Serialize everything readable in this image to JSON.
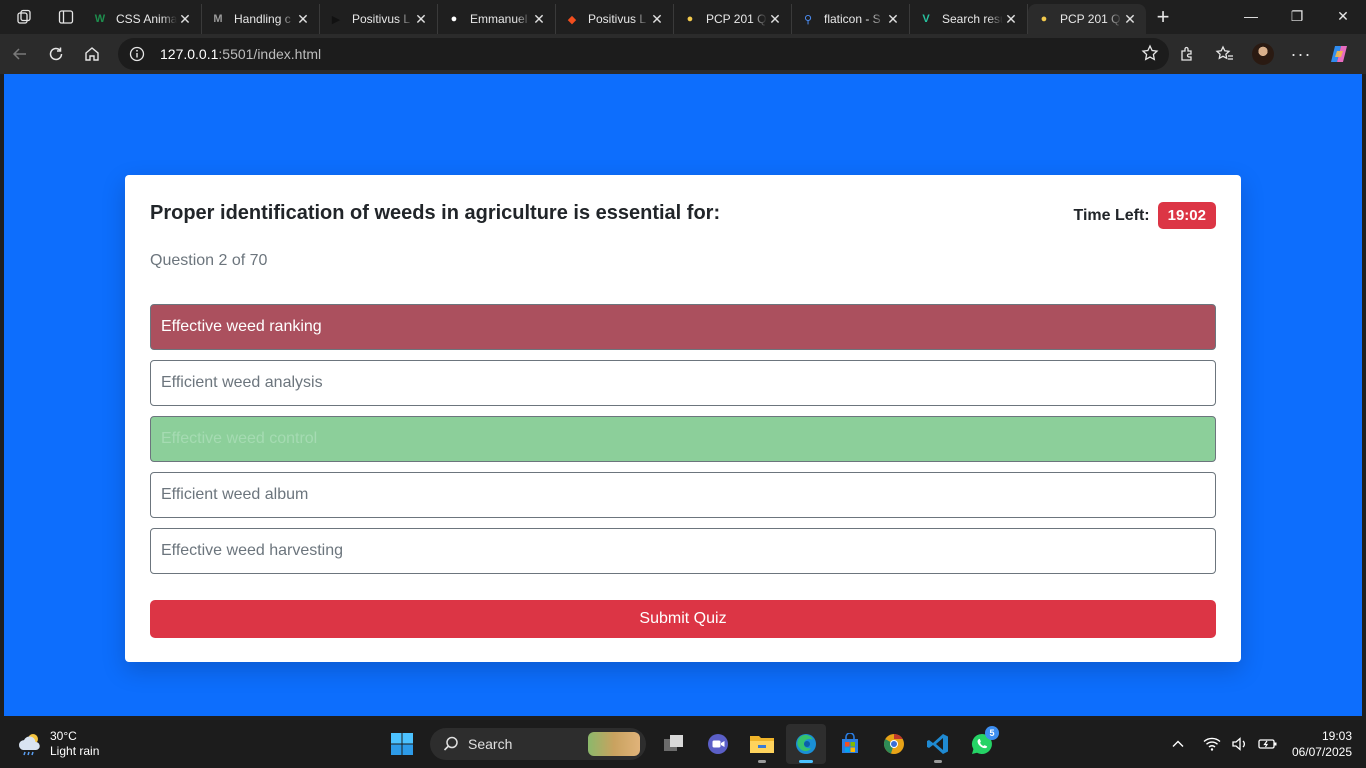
{
  "browser": {
    "tabs": [
      {
        "title": "CSS Anima",
        "favicon": "w-icon",
        "fav_color": "#1e8f4e"
      },
      {
        "title": "Handling c",
        "favicon": "m-icon",
        "fav_color": "#9a9a9a"
      },
      {
        "title": "Positivus L",
        "favicon": "play-icon",
        "fav_color": "#111111"
      },
      {
        "title": "Emmanuel",
        "favicon": "github-icon",
        "fav_color": "#ffffff"
      },
      {
        "title": "Positivus L",
        "favicon": "figma-icon",
        "fav_color": "#f24e1e"
      },
      {
        "title": "PCP 201 Q",
        "favicon": "bulb-icon",
        "fav_color": "#f2c94c"
      },
      {
        "title": "flaticon - S",
        "favicon": "search-icon",
        "fav_color": "#4c8ff7"
      },
      {
        "title": "Search resu",
        "favicon": "v-icon",
        "fav_color": "#27c3a0"
      },
      {
        "title": "PCP 201 Q",
        "favicon": "bulb-icon",
        "fav_color": "#f2c94c",
        "active": true
      }
    ],
    "url_host": "127.0.0.1",
    "url_path": ":5501/index.html"
  },
  "quiz": {
    "question": "Proper identification of weeds in agriculture is essential for:",
    "timer_label": "Time Left:",
    "timer_value": "19:02",
    "progress": "Question 2 of 70",
    "options": [
      {
        "label": "Effective weed ranking",
        "state": "wrong"
      },
      {
        "label": "Efficient weed analysis",
        "state": "none"
      },
      {
        "label": "Effective weed control",
        "state": "correct"
      },
      {
        "label": "Efficient weed album",
        "state": "none"
      },
      {
        "label": "Effective weed harvesting",
        "state": "none"
      }
    ],
    "submit_label": "Submit Quiz"
  },
  "colors": {
    "page_bg": "#0d6efd",
    "danger": "#dc3545",
    "wrong_answer": "#ab505e",
    "correct_answer": "#8ccf9a"
  },
  "taskbar": {
    "weather_temp": "30°C",
    "weather_desc": "Light rain",
    "search_label": "Search",
    "whatsapp_badge": "5",
    "time": "19:03",
    "date": "06/07/2025"
  }
}
